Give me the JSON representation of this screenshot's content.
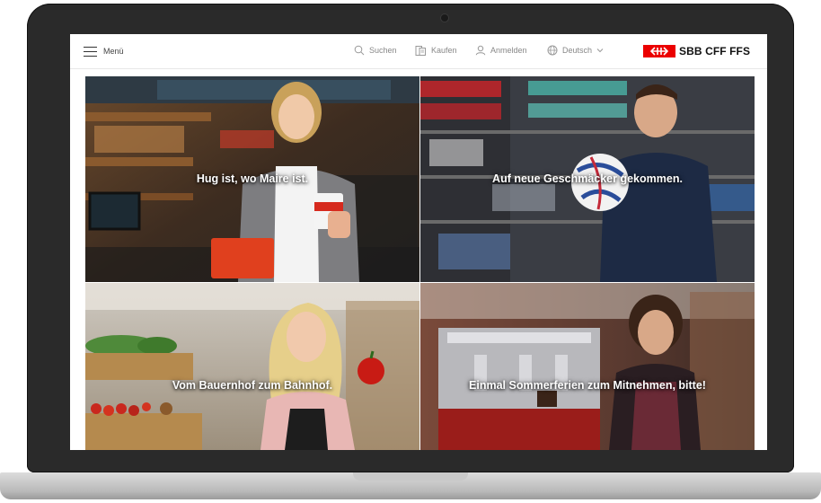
{
  "header": {
    "menu_label": "Menü",
    "search_label": "Suchen",
    "buy_label": "Kaufen",
    "login_label": "Anmelden",
    "language_label": "Deutsch",
    "logo_text": "SBB CFF FFS"
  },
  "tiles": [
    {
      "caption": "Hug ist, wo Maire ist."
    },
    {
      "caption": "Auf neue Geschmäcker gekommen."
    },
    {
      "caption": "Vom Bauernhof zum Bahnhof."
    },
    {
      "caption": "Einmal Sommerferien zum Mitnehmen, bitte!"
    }
  ],
  "colors": {
    "brand_red": "#eb0000",
    "laptop_bezel": "#2a2a2a",
    "header_text": "#888888"
  },
  "icons": [
    "menu-icon",
    "search-icon",
    "ticket-icon",
    "user-icon",
    "globe-icon",
    "chevron-down-icon",
    "sbb-logo-icon"
  ]
}
